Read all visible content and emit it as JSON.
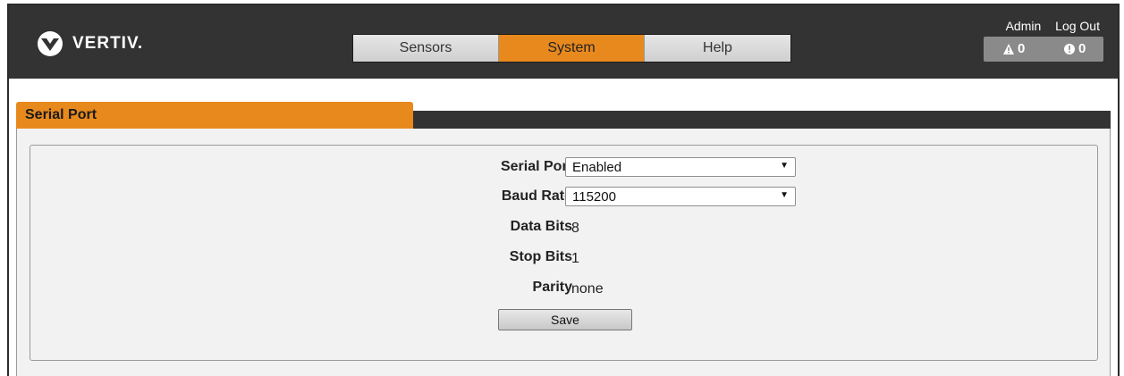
{
  "brand": {
    "name": "VERTIV."
  },
  "nav": {
    "tabs": [
      "Sensors",
      "System",
      "Help"
    ],
    "active_index": 1
  },
  "user": {
    "admin_label": "Admin",
    "logout_label": "Log Out"
  },
  "alerts": {
    "warning_count": "0",
    "critical_count": "0"
  },
  "panel": {
    "title": "Serial Port"
  },
  "form": {
    "serial_port": {
      "label": "Serial Port",
      "value": "Enabled"
    },
    "baud_rate": {
      "label": "Baud Rate",
      "value": "115200"
    },
    "data_bits": {
      "label": "Data Bits",
      "value": "8"
    },
    "stop_bits": {
      "label": "Stop Bits",
      "value": "1"
    },
    "parity": {
      "label": "Parity",
      "value": "none"
    },
    "save_label": "Save"
  },
  "colors": {
    "accent": "#e8891d",
    "header": "#333333",
    "panel_bg": "#f2f2f2"
  }
}
